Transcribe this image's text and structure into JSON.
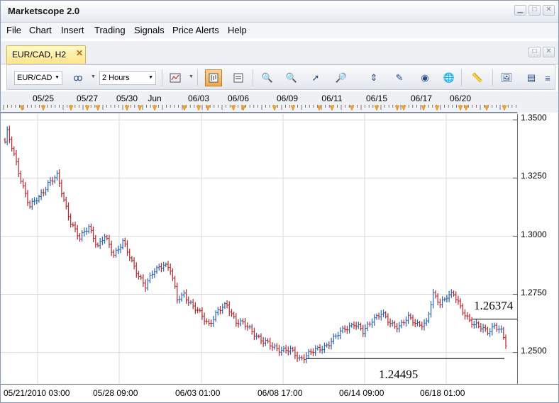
{
  "app": {
    "title": "Marketscope 2.0"
  },
  "menu": [
    "File",
    "Chart",
    "Insert",
    "Trading",
    "Signals",
    "Price Alerts",
    "Help"
  ],
  "tab": {
    "label": "EUR/CAD, H2",
    "close": "✕"
  },
  "toolbar": {
    "symbol": "EUR/CAD",
    "timeframe": "2 Hours"
  },
  "date_markers": [
    "05/25",
    "05/27",
    "05/30",
    "Jun",
    "06/03",
    "06/06",
    "06/09",
    "06/11",
    "06/15",
    "06/17",
    "06/20"
  ],
  "annotations": {
    "high_price": "1.26374",
    "low_price": "1.24495"
  },
  "colors": {
    "up_bar": "#2b63b5",
    "down_bar": "#b8262b",
    "accent": "#f2a33a"
  },
  "chart_data": {
    "type": "ohlc",
    "symbol": "EUR/CAD",
    "timeframe": "H2",
    "y_ticks": [
      "1.3500",
      "1.3250",
      "1.3000",
      "1.2750",
      "1.2500"
    ],
    "ylim": [
      1.2365,
      1.3525
    ],
    "x_labels": [
      "05/21/2010 03:00",
      "05/28 09:00",
      "06/03 01:00",
      "06/08 17:00",
      "06/14 09:00",
      "06/18 01:00"
    ],
    "trend": [
      [
        0,
        1.3405
      ],
      [
        1,
        1.3445
      ],
      [
        4,
        1.3345
      ],
      [
        8,
        1.3215
      ],
      [
        11,
        1.3125
      ],
      [
        15,
        1.3165
      ],
      [
        19,
        1.323
      ],
      [
        23,
        1.3255
      ],
      [
        26,
        1.3155
      ],
      [
        29,
        1.3065
      ],
      [
        33,
        1.2985
      ],
      [
        37,
        1.3045
      ],
      [
        41,
        1.2955
      ],
      [
        44,
        1.2995
      ],
      [
        48,
        1.2925
      ],
      [
        52,
        1.2975
      ],
      [
        56,
        1.2885
      ],
      [
        59,
        1.2835
      ],
      [
        62,
        1.2785
      ],
      [
        66,
        1.285
      ],
      [
        70,
        1.2885
      ],
      [
        73,
        1.2855
      ],
      [
        76,
        1.2725
      ],
      [
        79,
        1.2755
      ],
      [
        83,
        1.2695
      ],
      [
        87,
        1.2655
      ],
      [
        90,
        1.2625
      ],
      [
        94,
        1.2675
      ],
      [
        98,
        1.2705
      ],
      [
        102,
        1.2635
      ],
      [
        106,
        1.2615
      ],
      [
        110,
        1.2585
      ],
      [
        114,
        1.2545
      ],
      [
        118,
        1.2525
      ],
      [
        122,
        1.2515
      ],
      [
        126,
        1.2505
      ],
      [
        130,
        1.2475
      ],
      [
        134,
        1.2495
      ],
      [
        138,
        1.251
      ],
      [
        142,
        1.2535
      ],
      [
        146,
        1.2565
      ],
      [
        150,
        1.2605
      ],
      [
        154,
        1.2625
      ],
      [
        158,
        1.2585
      ],
      [
        162,
        1.2645
      ],
      [
        166,
        1.2665
      ],
      [
        170,
        1.2625
      ],
      [
        174,
        1.2615
      ],
      [
        178,
        1.2645
      ],
      [
        182,
        1.2625
      ],
      [
        186,
        1.2625
      ],
      [
        189,
        1.2745
      ],
      [
        192,
        1.2715
      ],
      [
        195,
        1.2745
      ],
      [
        198,
        1.2745
      ],
      [
        201,
        1.2695
      ],
      [
        204,
        1.2655
      ],
      [
        207,
        1.2615
      ],
      [
        210,
        1.2605
      ],
      [
        213,
        1.2595
      ],
      [
        216,
        1.2615
      ],
      [
        219,
        1.2585
      ],
      [
        221,
        1.2535
      ]
    ]
  }
}
